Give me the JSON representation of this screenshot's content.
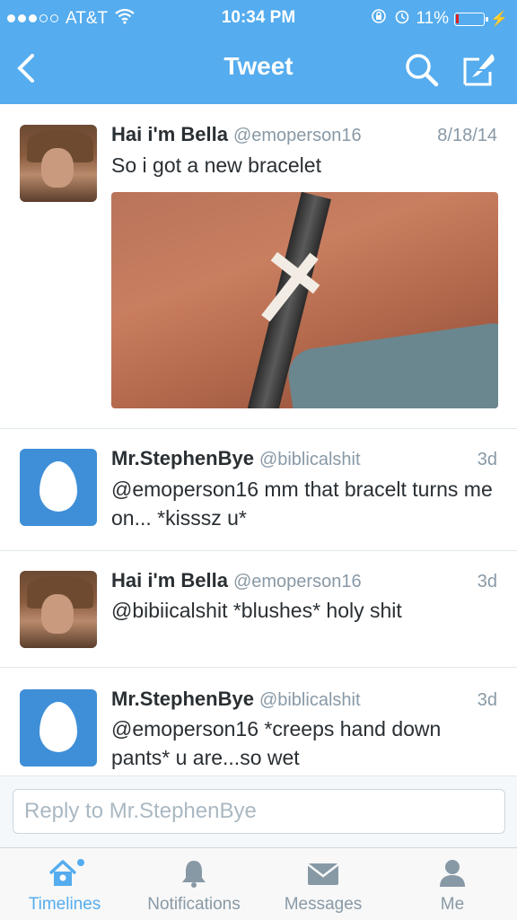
{
  "status_bar": {
    "carrier": "AT&T",
    "time": "10:34 PM",
    "battery_percent": "11%",
    "battery_level": 0.11,
    "signal_bars_filled": 3,
    "signal_bars_total": 5
  },
  "nav": {
    "title": "Tweet",
    "back_icon": "chevron-left-icon",
    "search_icon": "search-icon",
    "compose_icon": "compose-icon"
  },
  "tweets": [
    {
      "name": "Hai i'm Bella",
      "handle": "@emoperson16",
      "time": "8/18/14",
      "text": "So i got a new bracelet",
      "avatar": "photo"
    },
    {
      "name": "Mr.StephenBye",
      "handle": "@biblicalshit",
      "time": "3d",
      "text": "@emoperson16 mm that bracelt turns me on... *kisssz u*",
      "avatar": "egg"
    },
    {
      "name": "Hai i'm Bella",
      "handle": "@emoperson16",
      "time": "3d",
      "text": "@bibiicalshit *blushes* holy shit",
      "avatar": "photo"
    },
    {
      "name": "Mr.StephenBye",
      "handle": "@biblicalshit",
      "time": "3d",
      "text": "@emoperson16 *creeps hand down pants* u are...so wet",
      "avatar": "egg"
    }
  ],
  "reply": {
    "placeholder": "Reply to Mr.StephenBye"
  },
  "tabs": [
    {
      "label": "Timelines",
      "icon": "home-icon",
      "active": true
    },
    {
      "label": "Notifications",
      "icon": "bell-icon",
      "active": false
    },
    {
      "label": "Messages",
      "icon": "envelope-icon",
      "active": false
    },
    {
      "label": "Me",
      "icon": "person-icon",
      "active": false
    }
  ],
  "colors": {
    "brand": "#55acee",
    "battery_low": "#e02020"
  }
}
